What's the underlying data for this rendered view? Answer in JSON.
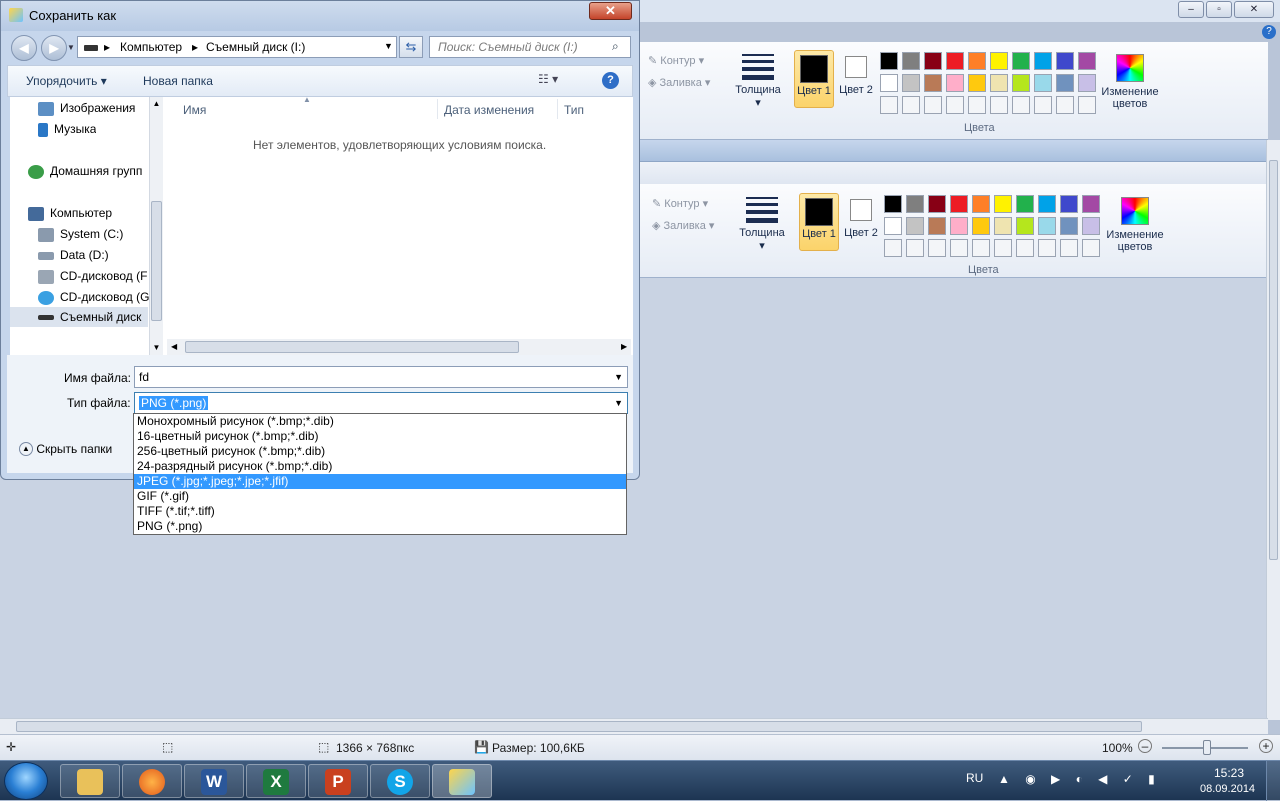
{
  "dialog": {
    "title": "Сохранить как",
    "address": {
      "root": "Компьютер",
      "location": "Съемный диск (I:)"
    },
    "search_placeholder": "Поиск: Съемный диск (I:)",
    "toolbar": {
      "organize": "Упорядочить",
      "new_folder": "Новая папка"
    },
    "nav_items": [
      "Изображения",
      "Музыка",
      "Домашняя групп",
      "Компьютер",
      "System (C:)",
      "Data (D:)",
      "CD-дисковод (F",
      "CD-дисковод (G",
      "Съемный диск"
    ],
    "columns": {
      "name": "Имя",
      "date": "Дата изменения",
      "type": "Тип"
    },
    "empty_message": "Нет элементов, удовлетворяющих условиям поиска.",
    "filename_label": "Имя файла:",
    "filename_value": "fd",
    "filetype_label": "Тип файла:",
    "filetype_value": "PNG (*.png)",
    "hide_folders": "Скрыть папки",
    "filetype_options": [
      "Монохромный рисунок (*.bmp;*.dib)",
      "16-цветный рисунок (*.bmp;*.dib)",
      "256-цветный рисунок (*.bmp;*.dib)",
      "24-разрядный рисунок (*.bmp;*.dib)",
      "JPEG (*.jpg;*.jpeg;*.jpe;*.jfif)",
      "GIF (*.gif)",
      "TIFF (*.tif;*.tiff)",
      "PNG (*.png)"
    ],
    "highlighted_option": "JPEG (*.jpg;*.jpeg;*.jpe;*.jfif)"
  },
  "ribbon": {
    "outline": "Контур",
    "fill": "Заливка",
    "thickness": "Толщина",
    "color1": "Цвет 1",
    "color2": "Цвет 2",
    "edit_colors": "Изменение цветов",
    "colors_group": "Цвета",
    "palette_row1": [
      "#000000",
      "#7f7f7f",
      "#880015",
      "#ed1c24",
      "#ff7f27",
      "#fff200",
      "#22b14c",
      "#00a2e8",
      "#3f48cc",
      "#a349a4"
    ],
    "palette_row2": [
      "#ffffff",
      "#c3c3c3",
      "#b97a57",
      "#ffaec9",
      "#ffc90e",
      "#efe4b0",
      "#b5e61d",
      "#99d9ea",
      "#7092be",
      "#c8bfe7"
    ]
  },
  "status": {
    "dimensions": "1366 × 768пкс",
    "size": "Размер: 100,6КБ",
    "zoom": "100%"
  },
  "tray": {
    "lang": "RU",
    "time": "15:23",
    "date": "08.09.2014"
  }
}
